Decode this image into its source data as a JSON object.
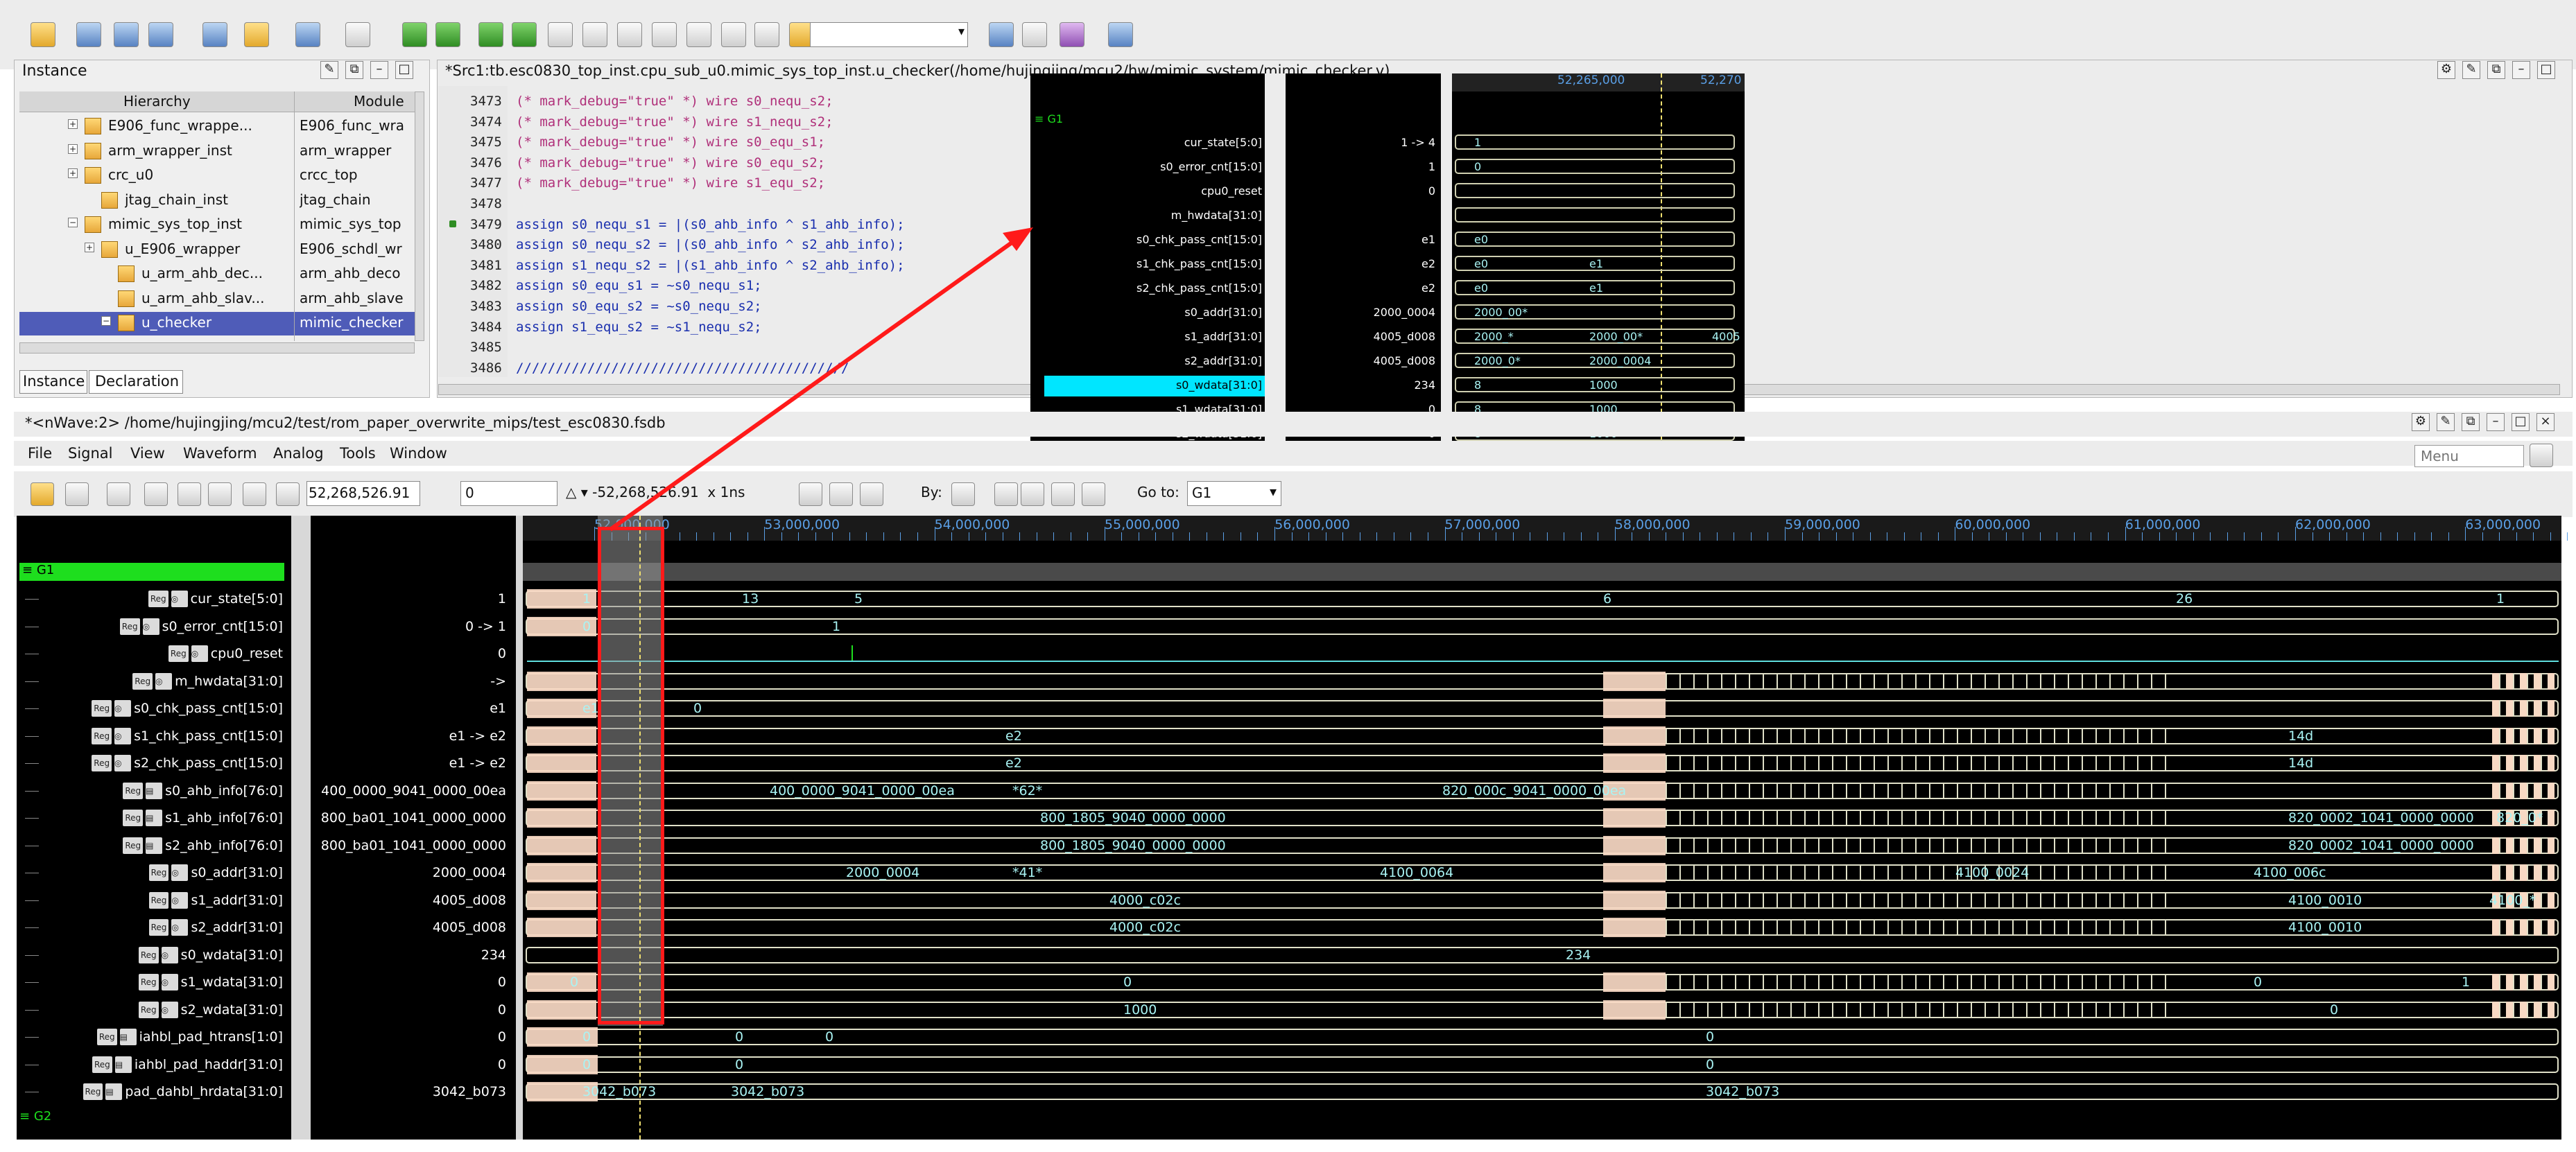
{
  "colors": {
    "accent_green": "#1ede1e",
    "wave_text": "#a9f3f3",
    "hilite_cyan": "#00e6ff",
    "annotation_red": "#ff1a1a",
    "selection_blue": "#4f5cb8"
  },
  "top_toolbar": {
    "dropdown_value": ""
  },
  "instance_panel": {
    "title": "Instance",
    "col_hierarchy": "Hierarchy",
    "col_module": "Module",
    "rows": [
      {
        "name": "E906_func_wrappe...",
        "module": "E906_func_wra"
      },
      {
        "name": "arm_wrapper_inst",
        "module": "arm_wrapper"
      },
      {
        "name": "crc_u0",
        "module": "crcc_top"
      },
      {
        "name": "jtag_chain_inst",
        "module": "jtag_chain"
      },
      {
        "name": "mimic_sys_top_inst",
        "module": "mimic_sys_top"
      },
      {
        "name": "u_E906_wrapper",
        "module": "E906_schdl_wr"
      },
      {
        "name": "u_arm_ahb_dec...",
        "module": "arm_ahb_deco"
      },
      {
        "name": "u_arm_ahb_slav...",
        "module": "arm_ahb_slave"
      },
      {
        "name": "u_checker",
        "module": "mimic_checker"
      }
    ],
    "tab_instance": "Instance",
    "tab_declaration": "Declaration"
  },
  "source_panel": {
    "title": "*Src1:tb.esc0830_top_inst.cpu_sub_u0.mimic_sys_top_inst.u_checker(/home/hujingjing/mcu2/hw/mimic_system/mimic_checker.v)",
    "lines": [
      {
        "n": "3473",
        "t": "(* mark_debug=\"true\" *) wire s0_nequ_s2;"
      },
      {
        "n": "3474",
        "t": "(* mark_debug=\"true\" *) wire s1_nequ_s2;"
      },
      {
        "n": "3475",
        "t": "(* mark_debug=\"true\" *) wire s0_equ_s1;"
      },
      {
        "n": "3476",
        "t": "(* mark_debug=\"true\" *) wire s0_equ_s2;"
      },
      {
        "n": "3477",
        "t": "(* mark_debug=\"true\" *) wire s1_equ_s2;"
      },
      {
        "n": "3478",
        "t": ""
      },
      {
        "n": "3479",
        "t": "assign s0_nequ_s1 = |(s0_ahb_info ^ s1_ahb_info);"
      },
      {
        "n": "3480",
        "t": "assign s0_nequ_s2 = |(s0_ahb_info ^ s2_ahb_info);"
      },
      {
        "n": "3481",
        "t": "assign s1_nequ_s2 = |(s1_ahb_info ^ s2_ahb_info);"
      },
      {
        "n": "3482",
        "t": "assign s0_equ_s1 = ~s0_nequ_s1;"
      },
      {
        "n": "3483",
        "t": "assign s0_equ_s2 = ~s0_nequ_s2;"
      },
      {
        "n": "3484",
        "t": "assign s1_equ_s2 = ~s1_nequ_s2;"
      },
      {
        "n": "3485",
        "t": ""
      },
      {
        "n": "3486",
        "t": "//////////////////////////////////////////"
      }
    ]
  },
  "zoom": {
    "group": "G1",
    "time1": "52,265,000",
    "time2": "52,270",
    "signals": [
      {
        "name": "cur_state[5:0]",
        "val": "1 -> 4"
      },
      {
        "name": "s0_error_cnt[15:0]",
        "val": "1"
      },
      {
        "name": "cpu0_reset",
        "val": "0"
      },
      {
        "name": "m_hwdata[31:0]",
        "val": ""
      },
      {
        "name": "s0_chk_pass_cnt[15:0]",
        "val": "e1"
      },
      {
        "name": "s1_chk_pass_cnt[15:0]",
        "val": "e2"
      },
      {
        "name": "s2_chk_pass_cnt[15:0]",
        "val": "e2"
      },
      {
        "name": "s0_addr[31:0]",
        "val": "2000_0004"
      },
      {
        "name": "s1_addr[31:0]",
        "val": "4005_d008"
      },
      {
        "name": "s2_addr[31:0]",
        "val": "4005_d008"
      },
      {
        "name": "s0_wdata[31:0]",
        "val": "234"
      },
      {
        "name": "s1_wdata[31:0]",
        "val": "0"
      },
      {
        "name": "s2_wdata[31:0]",
        "val": "0"
      }
    ],
    "wave": [
      "1",
      "0",
      "",
      "",
      "e0",
      "e0",
      "e0",
      "2000_00*",
      "2000_*",
      "2000_0*",
      "8",
      "8",
      "8"
    ],
    "wave2": [
      "",
      "",
      "",
      "",
      "",
      "e1",
      "e1",
      "",
      "2000_00*",
      "2000_0004",
      "1000",
      "1000",
      "1000"
    ],
    "extra": "4005"
  },
  "nwave_title": "*<nWave:2> /home/hujingjing/mcu2/test/rom_paper_overwrite_mips/test_esc0830.fsdb",
  "menu": [
    "File",
    "Signal",
    "View",
    "Waveform",
    "Analog",
    "Tools",
    "Window"
  ],
  "menu_search_placeholder": "Menu",
  "wave_toolbar": {
    "cursor_time": "52,268,526.91",
    "marker_value": "0",
    "delta": "-52,268,526.91",
    "unit": "x 1ns",
    "by_label": "By:",
    "goto_label": "Go to:",
    "goto_value": "G1"
  },
  "timeline": [
    "52,000,000",
    "53,000,000",
    "54,000,000",
    "55,000,000",
    "56,000,000",
    "57,000,000",
    "58,000,000",
    "59,000,000",
    "60,000,000",
    "61,000,000",
    "62,000,000",
    "63,000,000"
  ],
  "groups": {
    "g1": "G1",
    "g2": "G2"
  },
  "signals": [
    {
      "name": "cur_state[5:0]",
      "val": "1",
      "w": [
        "1",
        "13",
        "5",
        "6",
        "26",
        "1"
      ]
    },
    {
      "name": "s0_error_cnt[15:0]",
      "val": "0 -> 1",
      "w": [
        "0",
        "1"
      ]
    },
    {
      "name": "cpu0_reset",
      "val": "0",
      "w": []
    },
    {
      "name": "m_hwdata[31:0]",
      "val": "->",
      "w": []
    },
    {
      "name": "s0_chk_pass_cnt[15:0]",
      "val": "e1",
      "w": [
        "e1",
        "0"
      ]
    },
    {
      "name": "s1_chk_pass_cnt[15:0]",
      "val": "e1 -> e2",
      "w": [
        "e2",
        "14d"
      ]
    },
    {
      "name": "s2_chk_pass_cnt[15:0]",
      "val": "e1 -> e2",
      "w": [
        "e2",
        "14d"
      ]
    },
    {
      "name": "s0_ahb_info[76:0]",
      "val": "400_0000_9041_0000_00ea",
      "w": [
        "400_0000_9041_0000_00ea",
        "*62*",
        "820_000c_9041_0000_00ea"
      ]
    },
    {
      "name": "s1_ahb_info[76:0]",
      "val": "800_ba01_1041_0000_0000",
      "w": [
        "800_1805_9040_0000_0000",
        "820_0002_1041_0000_0000",
        "820_0*"
      ]
    },
    {
      "name": "s2_ahb_info[76:0]",
      "val": "800_ba01_1041_0000_0000",
      "w": [
        "800_1805_9040_0000_0000",
        "820_0002_1041_0000_0000"
      ]
    },
    {
      "name": "s0_addr[31:0]",
      "val": "2000_0004",
      "w": [
        "2000_0004",
        "*41*",
        "4100_0064",
        "4100_0024",
        "4100_006c"
      ]
    },
    {
      "name": "s1_addr[31:0]",
      "val": "4005_d008",
      "w": [
        "4000_c02c",
        "4100_0010",
        "4100_*"
      ]
    },
    {
      "name": "s2_addr[31:0]",
      "val": "4005_d008",
      "w": [
        "4000_c02c",
        "4100_0010"
      ]
    },
    {
      "name": "s0_wdata[31:0]",
      "val": "234",
      "w": [
        "234"
      ]
    },
    {
      "name": "s1_wdata[31:0]",
      "val": "0",
      "w": [
        "0",
        "0",
        "0",
        "1"
      ]
    },
    {
      "name": "s2_wdata[31:0]",
      "val": "0",
      "w": [
        "1000",
        "0"
      ]
    },
    {
      "name": "iahbl_pad_htrans[1:0]",
      "val": "0",
      "w": [
        "0",
        "0",
        "0",
        "0"
      ]
    },
    {
      "name": "iahbl_pad_haddr[31:0]",
      "val": "0",
      "w": [
        "0",
        "0",
        "0"
      ]
    },
    {
      "name": "pad_dahbl_hrdata[31:0]",
      "val": "3042_b073",
      "w": [
        "3042_b073",
        "3042_b073",
        "3042_b073"
      ]
    }
  ],
  "tag_labels": {
    "reg": "Reg",
    "wire": "W"
  }
}
